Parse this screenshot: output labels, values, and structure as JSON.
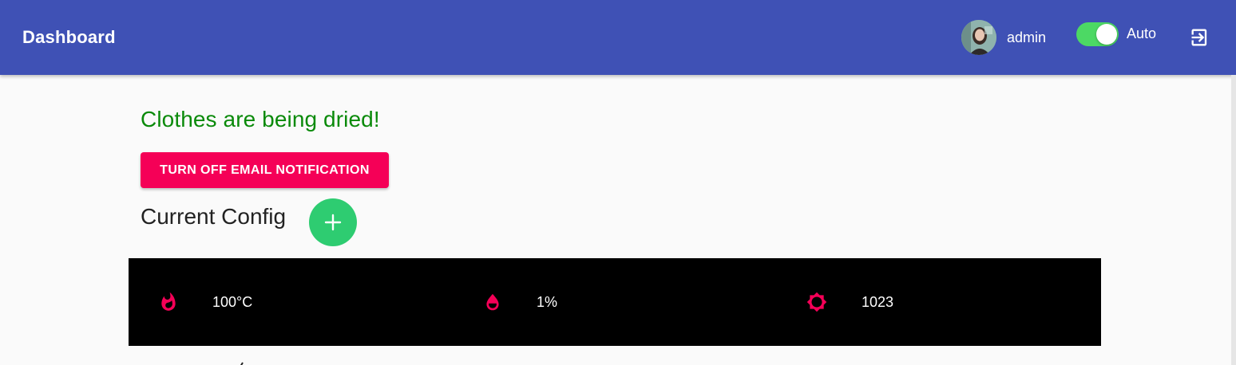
{
  "header": {
    "title": "Dashboard",
    "username": "admin",
    "auto_label": "Auto",
    "auto_enabled": true,
    "background_color": "#3f51b5"
  },
  "main": {
    "status_message": "Clothes are being dried!",
    "status_color": "#0a8a0a",
    "email_button_label": "TURN OFF EMAIL NOTIFICATION",
    "email_button_color": "#f50057",
    "section_title": "Current Config",
    "add_button_icon": "plus-icon",
    "add_button_color": "#2ecc71"
  },
  "config": {
    "items": [
      {
        "icon": "flame-icon",
        "value": "100°C"
      },
      {
        "icon": "water-drop-icon",
        "value": "1%"
      },
      {
        "icon": "sun-icon",
        "value": "1023"
      }
    ],
    "icon_color": "#f50057"
  }
}
